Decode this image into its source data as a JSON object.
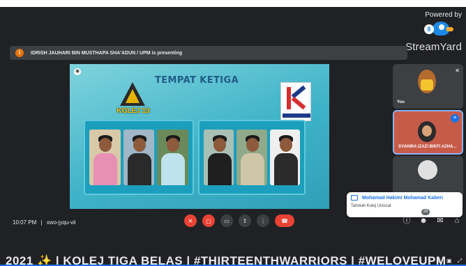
{
  "branding": {
    "powered_by": "Powered by",
    "name": "StreamYard",
    "badge": "8"
  },
  "presenting_bar": {
    "text": "IDRISH JAUHARI BIN MUSTHAPA SHA'ADUN / UPM is presenting"
  },
  "slide": {
    "title": "TEMPAT KETIGA",
    "kolej_logo_text": "KOLEJ 13"
  },
  "participants": [
    {
      "name": "You"
    },
    {
      "name": "SYAHIRA IZAZI BINTI AZHA..."
    },
    {
      "name": ""
    }
  ],
  "chat_notification": {
    "sender": "Mohamad Hakimi Mohamad Kaberi",
    "message": "Tahniah Kolej Uniszal"
  },
  "meeting": {
    "time": "10:07 PM",
    "separator": "|",
    "code": "xwo-jyqu-vii"
  },
  "controls": [
    {
      "icon": "mic-off-icon",
      "label": "Mic off"
    },
    {
      "icon": "camera-off-icon",
      "label": "Camera off"
    },
    {
      "icon": "captions-icon",
      "label": "Captions"
    },
    {
      "icon": "present-icon",
      "label": "Present"
    },
    {
      "icon": "more-options-icon",
      "label": "More options"
    },
    {
      "icon": "end-call-icon",
      "label": "Leave call"
    }
  ],
  "side_controls": {
    "people_count": "28"
  },
  "ticker": {
    "text": "2021 ✨ | KOLEJ TIGA BELAS | #THIRTEENTHWARRIORS | #WELOVEUPM"
  },
  "colors": {
    "background": "#202124",
    "end_call": "#ea4335",
    "slide_teal": "#3fb3c8",
    "accent_blue": "#1a73e8"
  }
}
